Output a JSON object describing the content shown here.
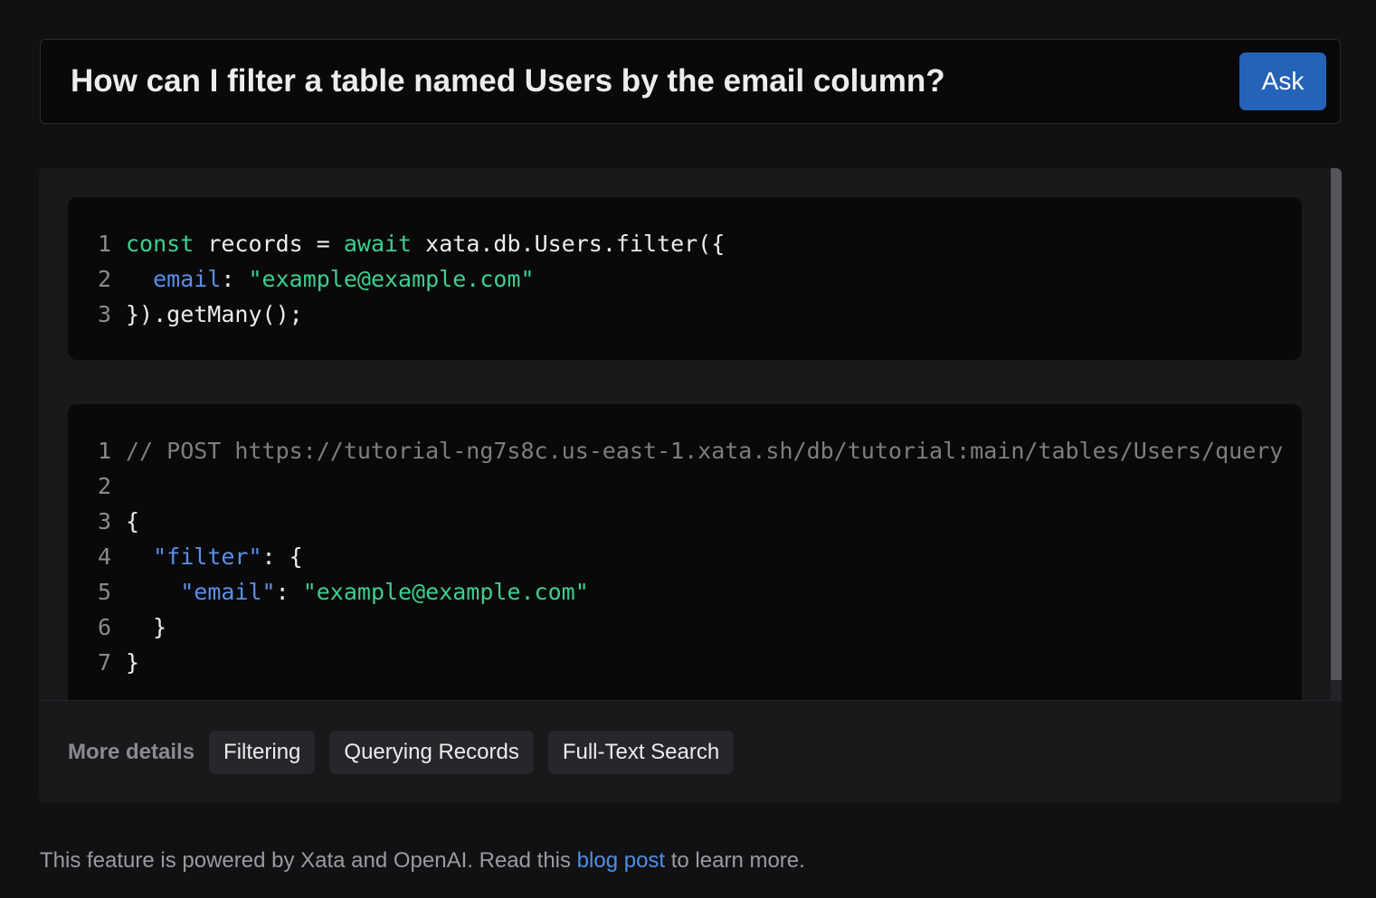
{
  "ask": {
    "question": "How can I filter a table named Users by the email column?",
    "button_label": "Ask"
  },
  "code_blocks": [
    {
      "lines": [
        {
          "n": "1",
          "tokens": [
            [
              "kw",
              "const"
            ],
            [
              "punc",
              " records = "
            ],
            [
              "kw",
              "await"
            ],
            [
              "punc",
              " xata.db.Users.filter({"
            ]
          ]
        },
        {
          "n": "2",
          "tokens": [
            [
              "punc",
              "  "
            ],
            [
              "prop",
              "email"
            ],
            [
              "punc",
              ": "
            ],
            [
              "str",
              "\"example@example.com\""
            ]
          ]
        },
        {
          "n": "3",
          "tokens": [
            [
              "punc",
              "}).getMany();"
            ]
          ]
        }
      ]
    },
    {
      "lines": [
        {
          "n": "1",
          "tokens": [
            [
              "cmt",
              "// POST https://tutorial-ng7s8c.us-east-1.xata.sh/db/tutorial:main/tables/Users/query"
            ]
          ]
        },
        {
          "n": "2",
          "tokens": [
            [
              "punc",
              ""
            ]
          ]
        },
        {
          "n": "3",
          "tokens": [
            [
              "punc",
              "{"
            ]
          ]
        },
        {
          "n": "4",
          "tokens": [
            [
              "punc",
              "  "
            ],
            [
              "prop",
              "\"filter\""
            ],
            [
              "punc",
              ": {"
            ]
          ]
        },
        {
          "n": "5",
          "tokens": [
            [
              "punc",
              "    "
            ],
            [
              "prop",
              "\"email\""
            ],
            [
              "punc",
              ": "
            ],
            [
              "str",
              "\"example@example.com\""
            ]
          ]
        },
        {
          "n": "6",
          "tokens": [
            [
              "punc",
              "  }"
            ]
          ]
        },
        {
          "n": "7",
          "tokens": [
            [
              "punc",
              "}"
            ]
          ]
        }
      ]
    }
  ],
  "details": {
    "label": "More details",
    "chips": [
      "Filtering",
      "Querying Records",
      "Full-Text Search"
    ]
  },
  "footer": {
    "before": "This feature is powered by Xata and OpenAI. Read this ",
    "link": "blog post",
    "after": " to learn more."
  },
  "colors": {
    "accent": "#2563b8",
    "keyword": "#3ecf8e",
    "property": "#5b8fe6",
    "link": "#4b8fe8"
  }
}
